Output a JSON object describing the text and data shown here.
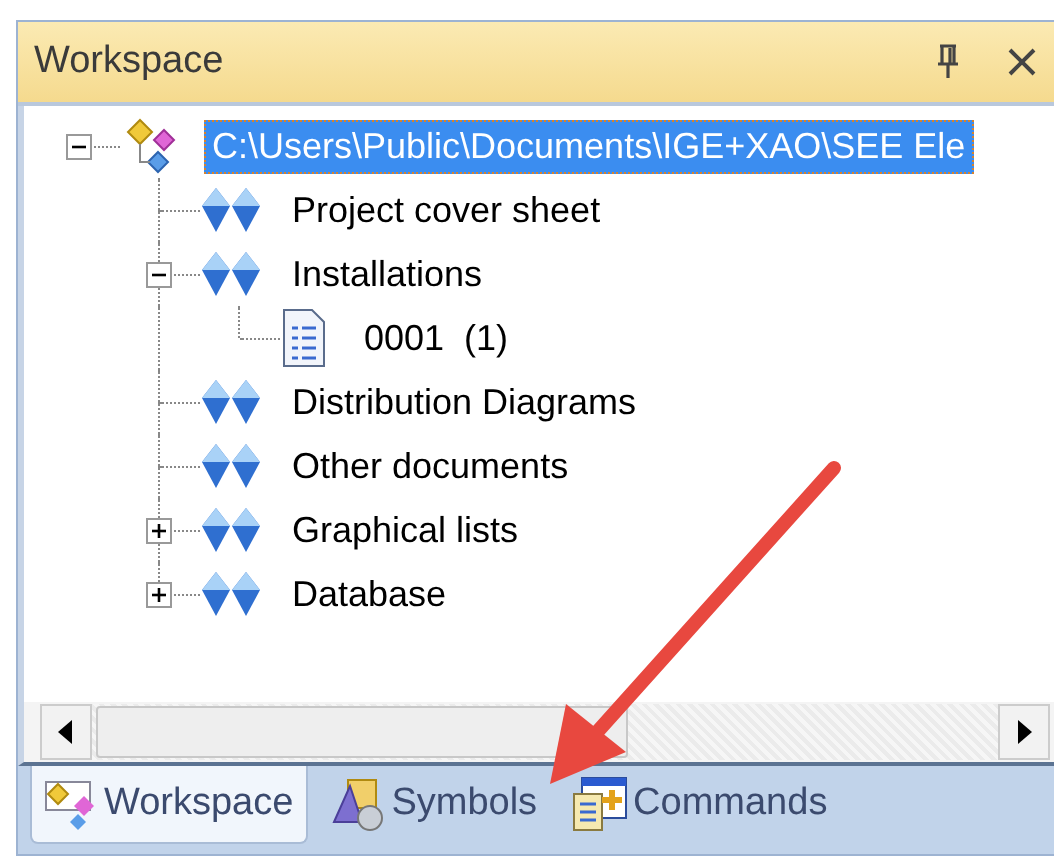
{
  "panel": {
    "title": "Workspace"
  },
  "tree": [
    {
      "label": "C:\\Users\\Public\\Documents\\IGE+XAO\\SEE Ele",
      "kind": "project",
      "expanded": true,
      "selected": true,
      "children": [
        {
          "label": "Project cover sheet",
          "kind": "folder",
          "selected": false
        },
        {
          "label": "Installations",
          "kind": "folder",
          "expanded": true,
          "selected": false,
          "children": [
            {
              "label": "0001  (1)",
              "kind": "document",
              "selected": false
            }
          ]
        },
        {
          "label": "Distribution Diagrams",
          "kind": "folder",
          "selected": false
        },
        {
          "label": "Other documents",
          "kind": "folder",
          "selected": false
        },
        {
          "label": "Graphical lists",
          "kind": "folder",
          "expanded": false,
          "selected": false
        },
        {
          "label": "Database",
          "kind": "folder",
          "expanded": false,
          "selected": false
        }
      ]
    }
  ],
  "tabs": [
    {
      "label": "Workspace",
      "kind": "workspace",
      "selected": true
    },
    {
      "label": "Symbols",
      "kind": "symbols",
      "selected": false
    },
    {
      "label": "Commands",
      "kind": "commands",
      "selected": false
    }
  ]
}
